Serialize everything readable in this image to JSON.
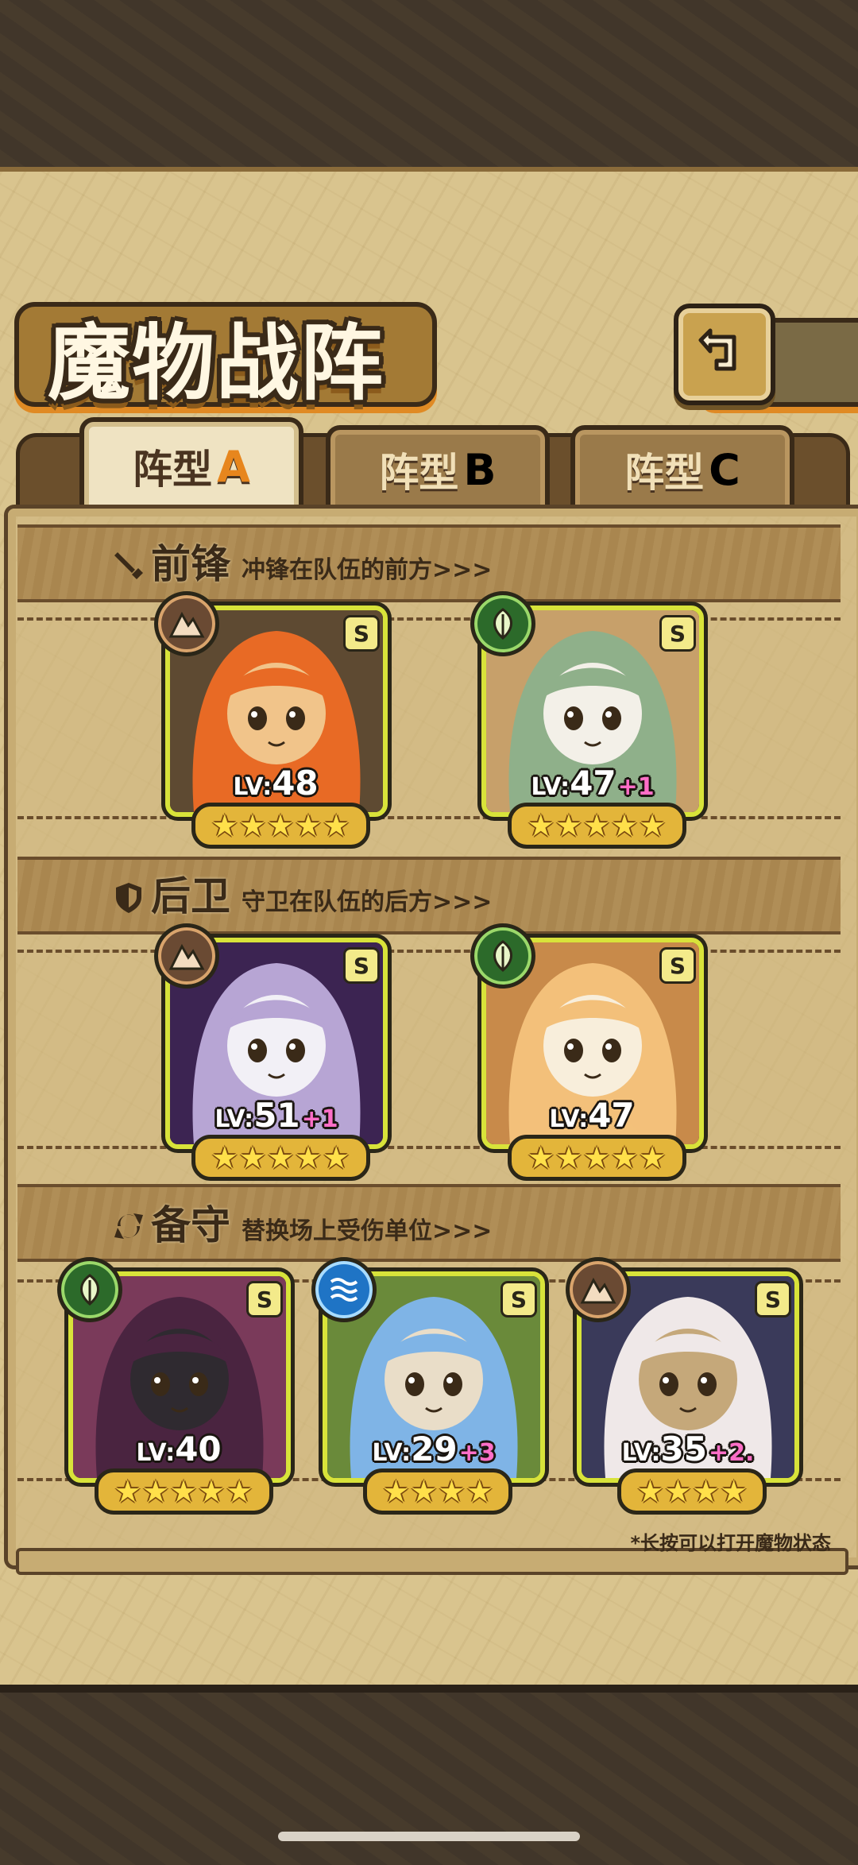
{
  "screen": {
    "title": "魔物战阵"
  },
  "tabs": [
    {
      "label": "阵型",
      "letter": "A",
      "active": true
    },
    {
      "label": "阵型",
      "letter": "B",
      "active": false
    },
    {
      "label": "阵型",
      "letter": "C",
      "active": false
    }
  ],
  "sections": {
    "front": {
      "title": "前锋",
      "subtitle": "冲锋在队伍的前方>>>",
      "icon": "sword-icon"
    },
    "rear": {
      "title": "后卫",
      "subtitle": "守卫在队伍的后方>>>",
      "icon": "shield-icon"
    },
    "reserve": {
      "title": "备守",
      "subtitle": "替换场上受伤单位>>>",
      "icon": "swap-icon"
    }
  },
  "units": {
    "front1": {
      "rank": "S",
      "element": "earth-icon",
      "lv": "48",
      "plus": "",
      "stars": "★★★★★",
      "palette": [
        "#e86a25",
        "#f1c48a",
        "#5e4a32"
      ]
    },
    "front2": {
      "rank": "S",
      "element": "leaf-icon",
      "lv": "47",
      "plus": "+1",
      "stars": "★★★★★",
      "palette": [
        "#8fb08a",
        "#f3f0e8",
        "#c7a06a"
      ]
    },
    "rear1": {
      "rank": "S",
      "element": "earth-icon",
      "lv": "51",
      "plus": "+1",
      "stars": "★★★★★",
      "palette": [
        "#b7a5d4",
        "#f2f0f6",
        "#3c2452"
      ]
    },
    "rear2": {
      "rank": "S",
      "element": "leaf-icon",
      "lv": "47",
      "plus": "",
      "stars": "★★★★★",
      "palette": [
        "#f3c07a",
        "#f8eedb",
        "#c88a4a"
      ]
    },
    "res1": {
      "rank": "S",
      "element": "leaf-icon",
      "lv": "40",
      "plus": "",
      "stars": "★★★★★",
      "palette": [
        "#4a2440",
        "#2f2a30",
        "#7a3a5a"
      ]
    },
    "res2": {
      "rank": "S",
      "element": "water-icon",
      "lv": "29",
      "plus": "+3",
      "stars": "★★★★",
      "palette": [
        "#7fb4e6",
        "#e9ddc8",
        "#6a8a3a"
      ]
    },
    "res3": {
      "rank": "S",
      "element": "earth-icon",
      "lv": "35",
      "plus": "+2.",
      "stars": "★★★★",
      "palette": [
        "#efe8e8",
        "#c5a87a",
        "#3a3a5a"
      ]
    }
  },
  "lv_prefix": "LV:",
  "hint": "*长按可以打开魔物状态"
}
